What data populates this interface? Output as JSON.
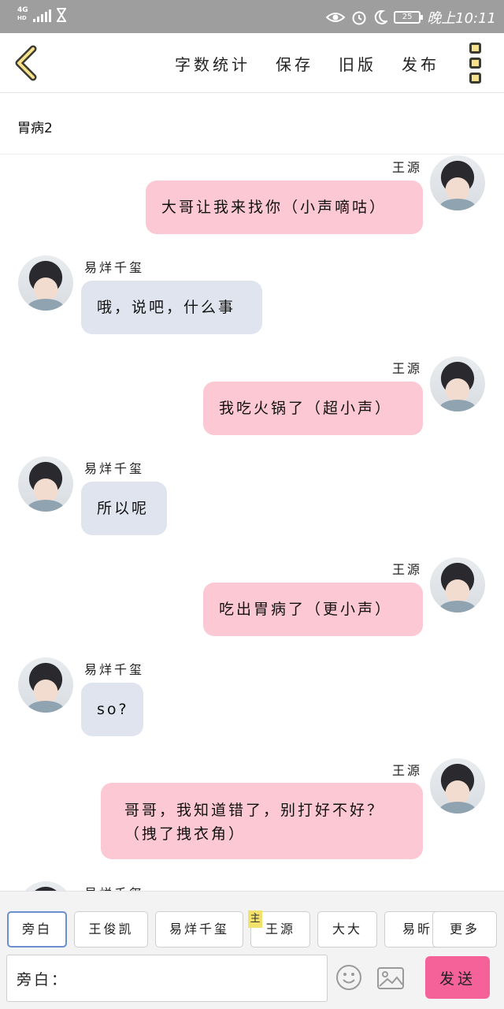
{
  "status_bar": {
    "network": "4G",
    "network_sub": "HD",
    "battery": "25",
    "time": "晚上10:11",
    "icons": [
      "signal-icon",
      "hourglass-icon",
      "eye-icon",
      "alarm-icon",
      "moon-icon",
      "battery-icon"
    ]
  },
  "toolbar": {
    "back_icon": "chevron-left-icon",
    "word_count_label": "字数统计",
    "save_label": "保存",
    "old_version_label": "旧版",
    "publish_label": "发布",
    "more_icon": "vertical-dots-icon",
    "accent_color": "#f6e08a"
  },
  "chapter": {
    "title": "胃病2"
  },
  "messages": [
    {
      "sender": "王源",
      "side": "right",
      "text": "大哥让我来找你（小声嘀咕）"
    },
    {
      "sender": "易烊千玺",
      "side": "left",
      "text": "哦，说吧，什么事"
    },
    {
      "sender": "王源",
      "side": "right",
      "text": "我吃火锅了（超小声）"
    },
    {
      "sender": "易烊千玺",
      "side": "left",
      "text": "所以呢"
    },
    {
      "sender": "王源",
      "side": "right",
      "text": "吃出胃病了（更小声）"
    },
    {
      "sender": "易烊千玺",
      "side": "left",
      "text": "so?"
    },
    {
      "sender": "王源",
      "side": "right",
      "text": "哥哥，我知道错了，别打好不好？（拽了拽衣角）"
    },
    {
      "sender": "易烊千玺",
      "side": "left",
      "text": ""
    }
  ],
  "colors": {
    "bubble_right": "#fcc8d4",
    "bubble_left": "#dfe4ee",
    "send_button": "#f5629a",
    "active_role_border": "#6b8fcf",
    "main_badge": "#f2e16a"
  },
  "roles": [
    {
      "label": "旁白",
      "active": true
    },
    {
      "label": "王俊凯",
      "active": false
    },
    {
      "label": "易烊千玺",
      "active": false
    },
    {
      "label": "王源",
      "active": false,
      "badge": "主"
    },
    {
      "label": "大大",
      "active": false
    },
    {
      "label": "易昕",
      "active": false
    },
    {
      "label": "更多",
      "active": false
    }
  ],
  "composer": {
    "value": "旁白：",
    "emoji_icon": "smiley-icon",
    "image_icon": "image-icon",
    "send_label": "发送"
  }
}
